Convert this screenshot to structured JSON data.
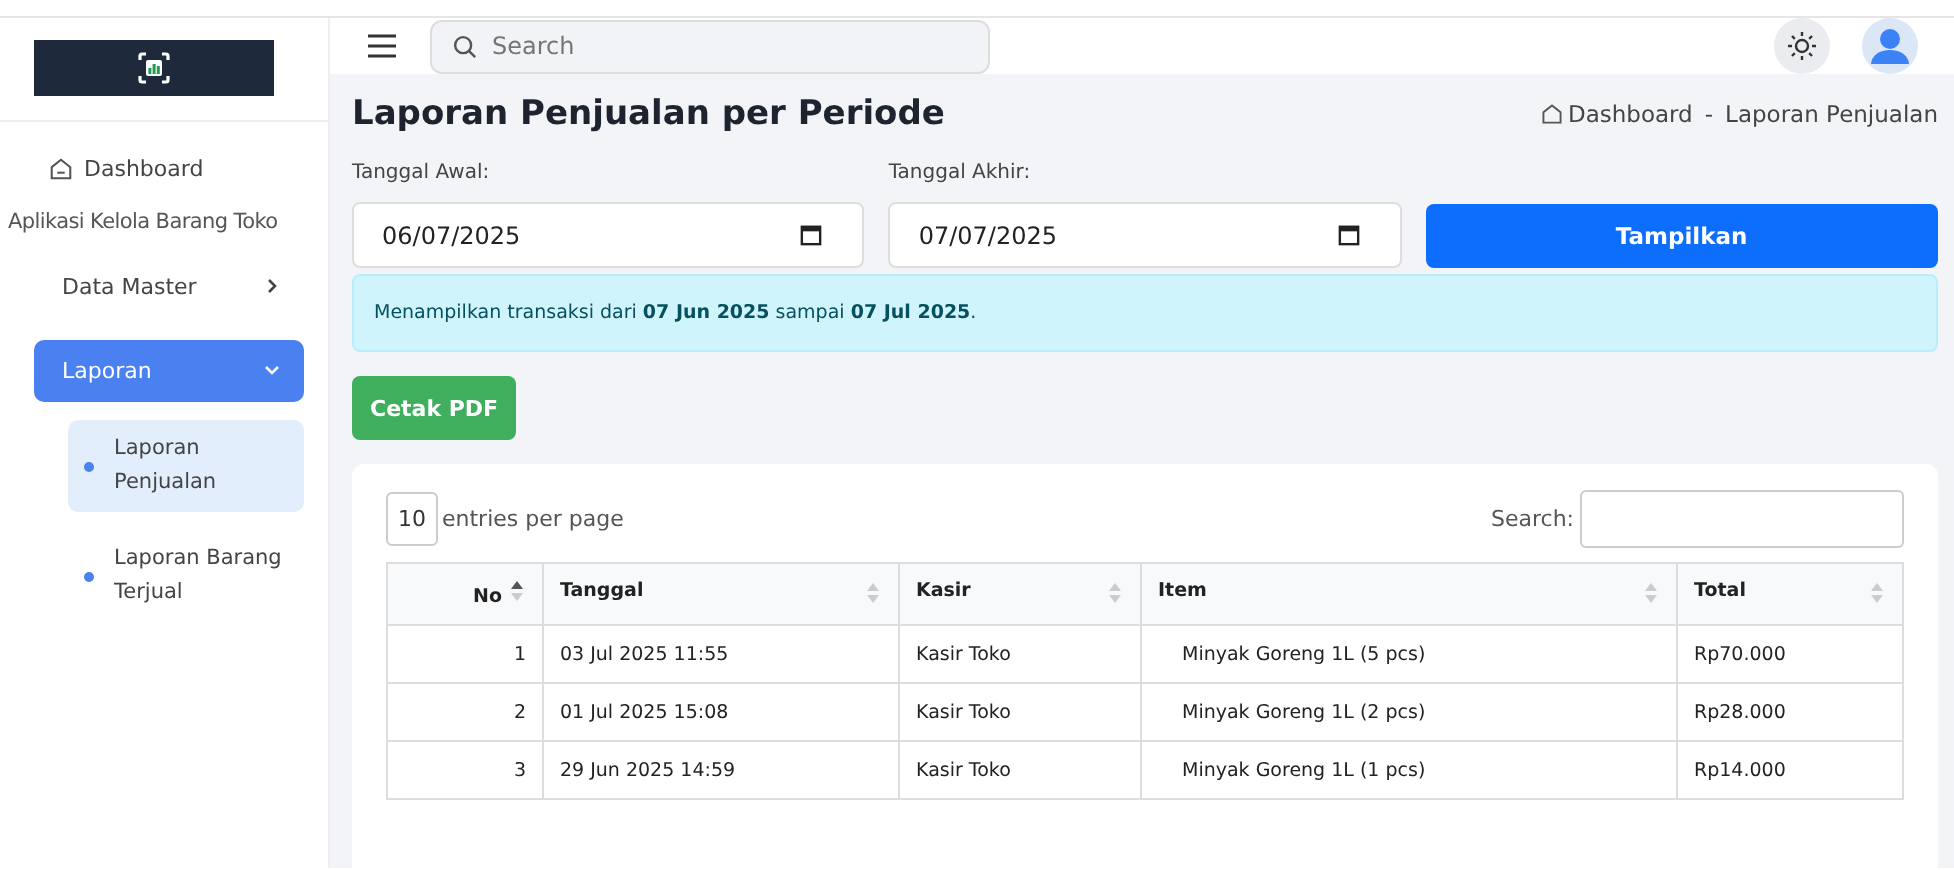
{
  "sidebar": {
    "items": [
      {
        "label": "Dashboard",
        "kind": "home"
      },
      {
        "label": "Aplikasi Kelola Barang Toko",
        "kind": "heading"
      },
      {
        "label": "Data Master",
        "kind": "group",
        "expanded": false,
        "selected": false
      },
      {
        "label": "Laporan",
        "kind": "group",
        "expanded": true,
        "selected": true,
        "children": [
          {
            "label": "Laporan Penjualan",
            "selected": true
          },
          {
            "label": "Laporan Barang Terjual",
            "selected": false
          }
        ]
      }
    ]
  },
  "header": {
    "search": {
      "placeholder": "Search"
    }
  },
  "page": {
    "title": "Laporan Penjualan per Periode",
    "breadcrumb": [
      "Dashboard",
      "-",
      "Laporan Penjualan"
    ]
  },
  "filter": {
    "fields": [
      {
        "label": "Tanggal Awal:",
        "value": "06/07/2025"
      },
      {
        "label": "Tanggal Akhir:",
        "value": "07/07/2025"
      }
    ],
    "submit": "Tampilkan"
  },
  "alert": "Menampilkan transaksi dari **07 Jun 2025** sampai **07 Jul 2025**.",
  "print_button": "Cetak PDF",
  "table": {
    "page_size": "10",
    "page_size_label": "entries per page",
    "search_label": "Search:",
    "columns": [
      {
        "label": "No",
        "sorted": true
      },
      {
        "label": "Tanggal",
        "sorted": false
      },
      {
        "label": "Kasir",
        "sorted": false
      },
      {
        "label": "Item",
        "sorted": false
      },
      {
        "label": "Total",
        "sorted": false
      }
    ],
    "rows": [
      [
        "1",
        "03 Jul 2025 11:55",
        "Kasir Toko",
        "Minyak Goreng 1L (5 pcs)",
        "Rp70.000"
      ],
      [
        "2",
        "01 Jul 2025 15:08",
        "Kasir Toko",
        "Minyak Goreng 1L (2 pcs)",
        "Rp28.000"
      ],
      [
        "3",
        "29 Jun 2025 14:59",
        "Kasir Toko",
        "Minyak Goreng 1L (1 pcs)",
        "Rp14.000"
      ]
    ]
  }
}
